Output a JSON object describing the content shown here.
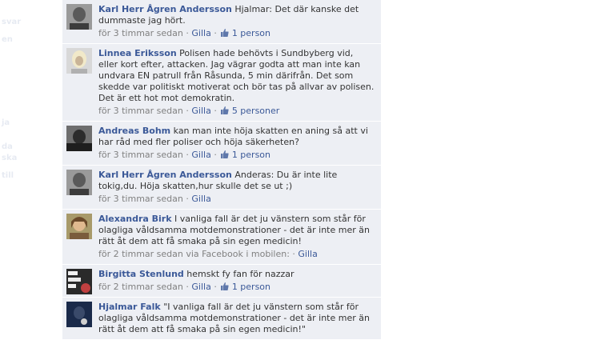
{
  "left_ghost": [
    "svar",
    "en",
    "ja",
    "da",
    "ska",
    "till"
  ],
  "comments": [
    {
      "author": "Karl Herr Ågren Andersson",
      "text": "Hjalmar: Det där kanske det dummaste jag hört.",
      "time": "för 3 timmar sedan",
      "like_label": "Gilla",
      "like_count": "1 person",
      "avatar": "man-grayscale"
    },
    {
      "author": "Linnea Eriksson",
      "text": "Polisen hade behövts i Sundbyberg vid, eller kort efter, attacken. Jag vägrar godta att man inte kan undvara EN patrull från Råsunda, 5 min därifrån. Det som skedde var politiskt motiverat och bör tas på allvar av polisen. Det är ett hot mot demokratin.",
      "time": "för 3 timmar sedan",
      "like_label": "Gilla",
      "like_count": "5 personer",
      "avatar": "woman-blonde"
    },
    {
      "author": "Andreas Bohm",
      "text": "kan man inte höja skatten en aning så att vi har råd med fler poliser och höja säkerheten?",
      "time": "för 3 timmar sedan",
      "like_label": "Gilla",
      "like_count": "1 person",
      "avatar": "man-dark"
    },
    {
      "author": "Karl Herr Ågren Andersson",
      "text": "Anderas: Du är inte lite tokig,du. Höja skatten,hur skulle det se ut ;)",
      "time": "för 3 timmar sedan",
      "like_label": "Gilla",
      "like_count": "",
      "avatar": "man-grayscale"
    },
    {
      "author": "Alexandra Birk",
      "text": "I vanliga fall är det ju vänstern som står för olagliga våldsamma motdemonstrationer - det är inte mer än rätt åt dem att få smaka på sin egen medicin!",
      "time": "för 2 timmar sedan via Facebook i mobilen",
      "like_label": "Gilla",
      "like_count": "",
      "avatar": "woman-brown"
    },
    {
      "author": "Birgitta Stenlund",
      "text": "hemskt fy fan för nazzar",
      "time": "för 2 timmar sedan",
      "like_label": "Gilla",
      "like_count": "1 person",
      "avatar": "poster"
    },
    {
      "author": "Hjalmar Falk",
      "text": "\"I vanliga fall är det ju vänstern som står för olagliga våldsamma motdemonstrationer - det är inte mer än rätt åt dem att få smaka på sin egen medicin!\"",
      "time": "",
      "like_label": "",
      "like_count": "",
      "avatar": "dark-blue"
    }
  ],
  "colors": {
    "link": "#3b5998",
    "feed_bg": "#edeff4",
    "meta": "#808080"
  }
}
